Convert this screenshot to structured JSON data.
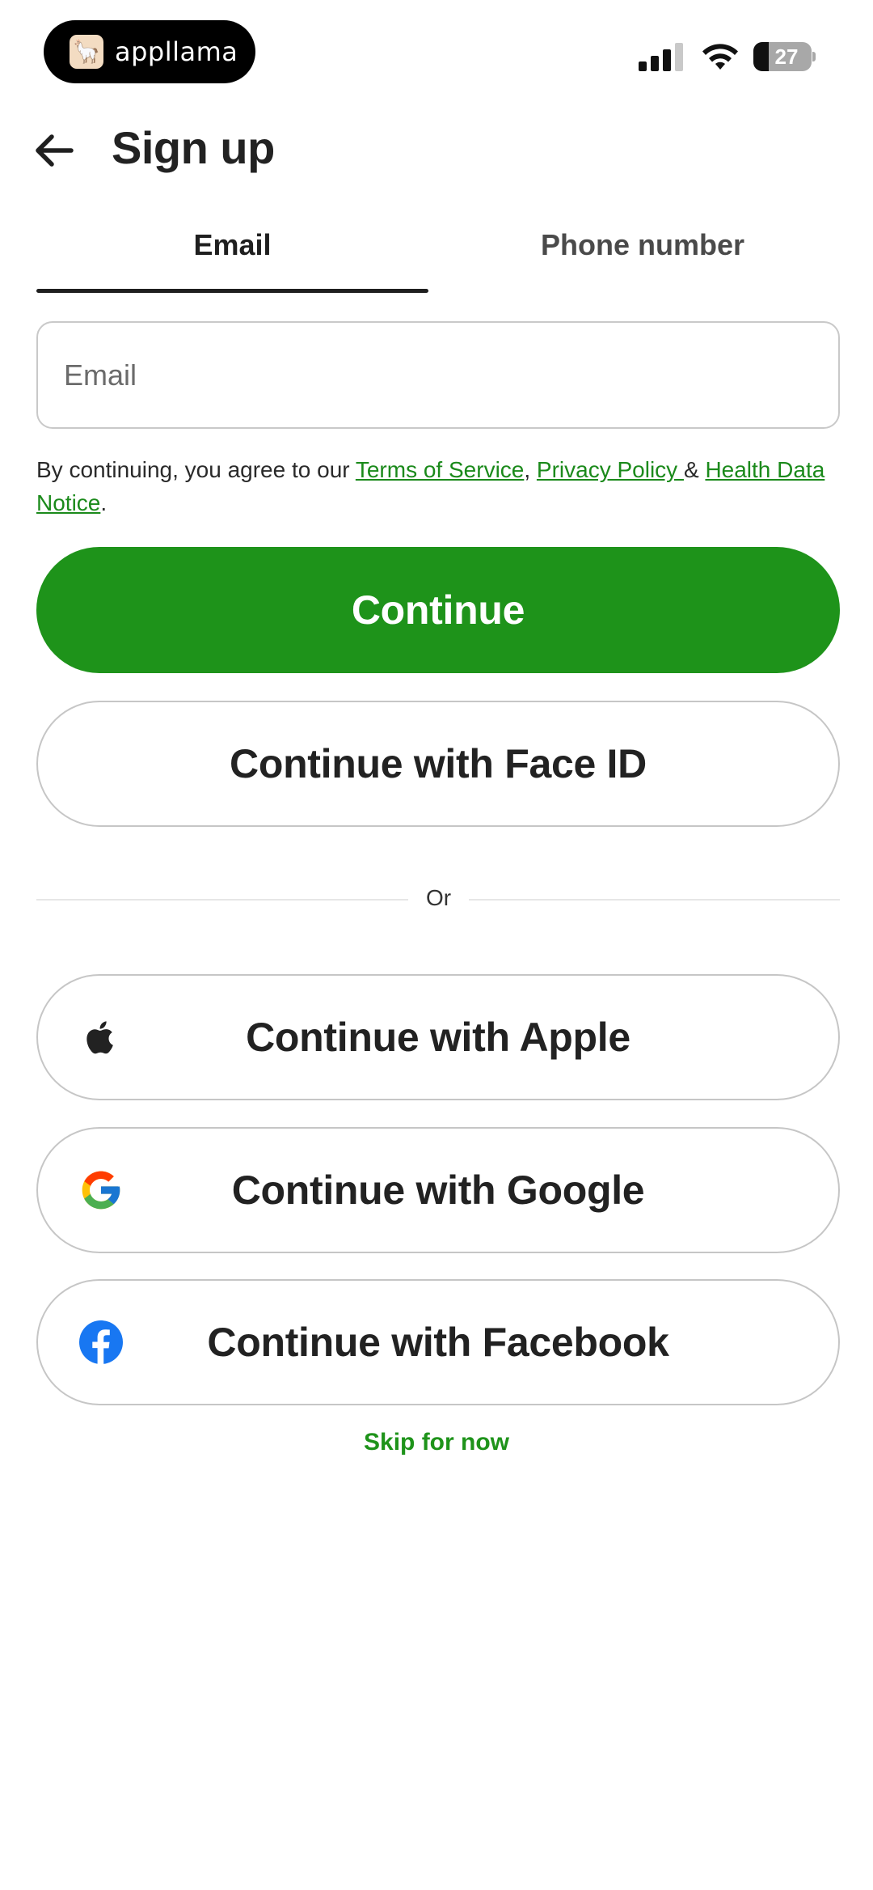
{
  "status_bar": {
    "app_badge_text": "appllama",
    "battery_level": "27",
    "signal_bars_active": 3,
    "signal_bars_total": 4
  },
  "header": {
    "back_icon": "arrow-left-icon",
    "title": "Sign up"
  },
  "tabs": [
    {
      "label": "Email",
      "selected": true
    },
    {
      "label": "Phone number",
      "selected": false
    }
  ],
  "form": {
    "email_placeholder": "Email",
    "email_value": ""
  },
  "legal": {
    "prefix": "By continuing, you agree to our ",
    "terms": "Terms of Service",
    "sep1": ", ",
    "privacy": "Privacy Policy ",
    "amp": "& ",
    "health": "Health Data Notice",
    "suffix": "."
  },
  "buttons": {
    "continue": "Continue",
    "face_id": "Continue with Face ID",
    "divider_text": "Or",
    "apple": "Continue with Apple",
    "google": "Continue with Google",
    "facebook": "Continue with Facebook",
    "skip": "Skip for now"
  },
  "colors": {
    "primary_green": "#1e931a",
    "link_green": "#1b8a1b",
    "facebook_blue": "#1877f2"
  }
}
